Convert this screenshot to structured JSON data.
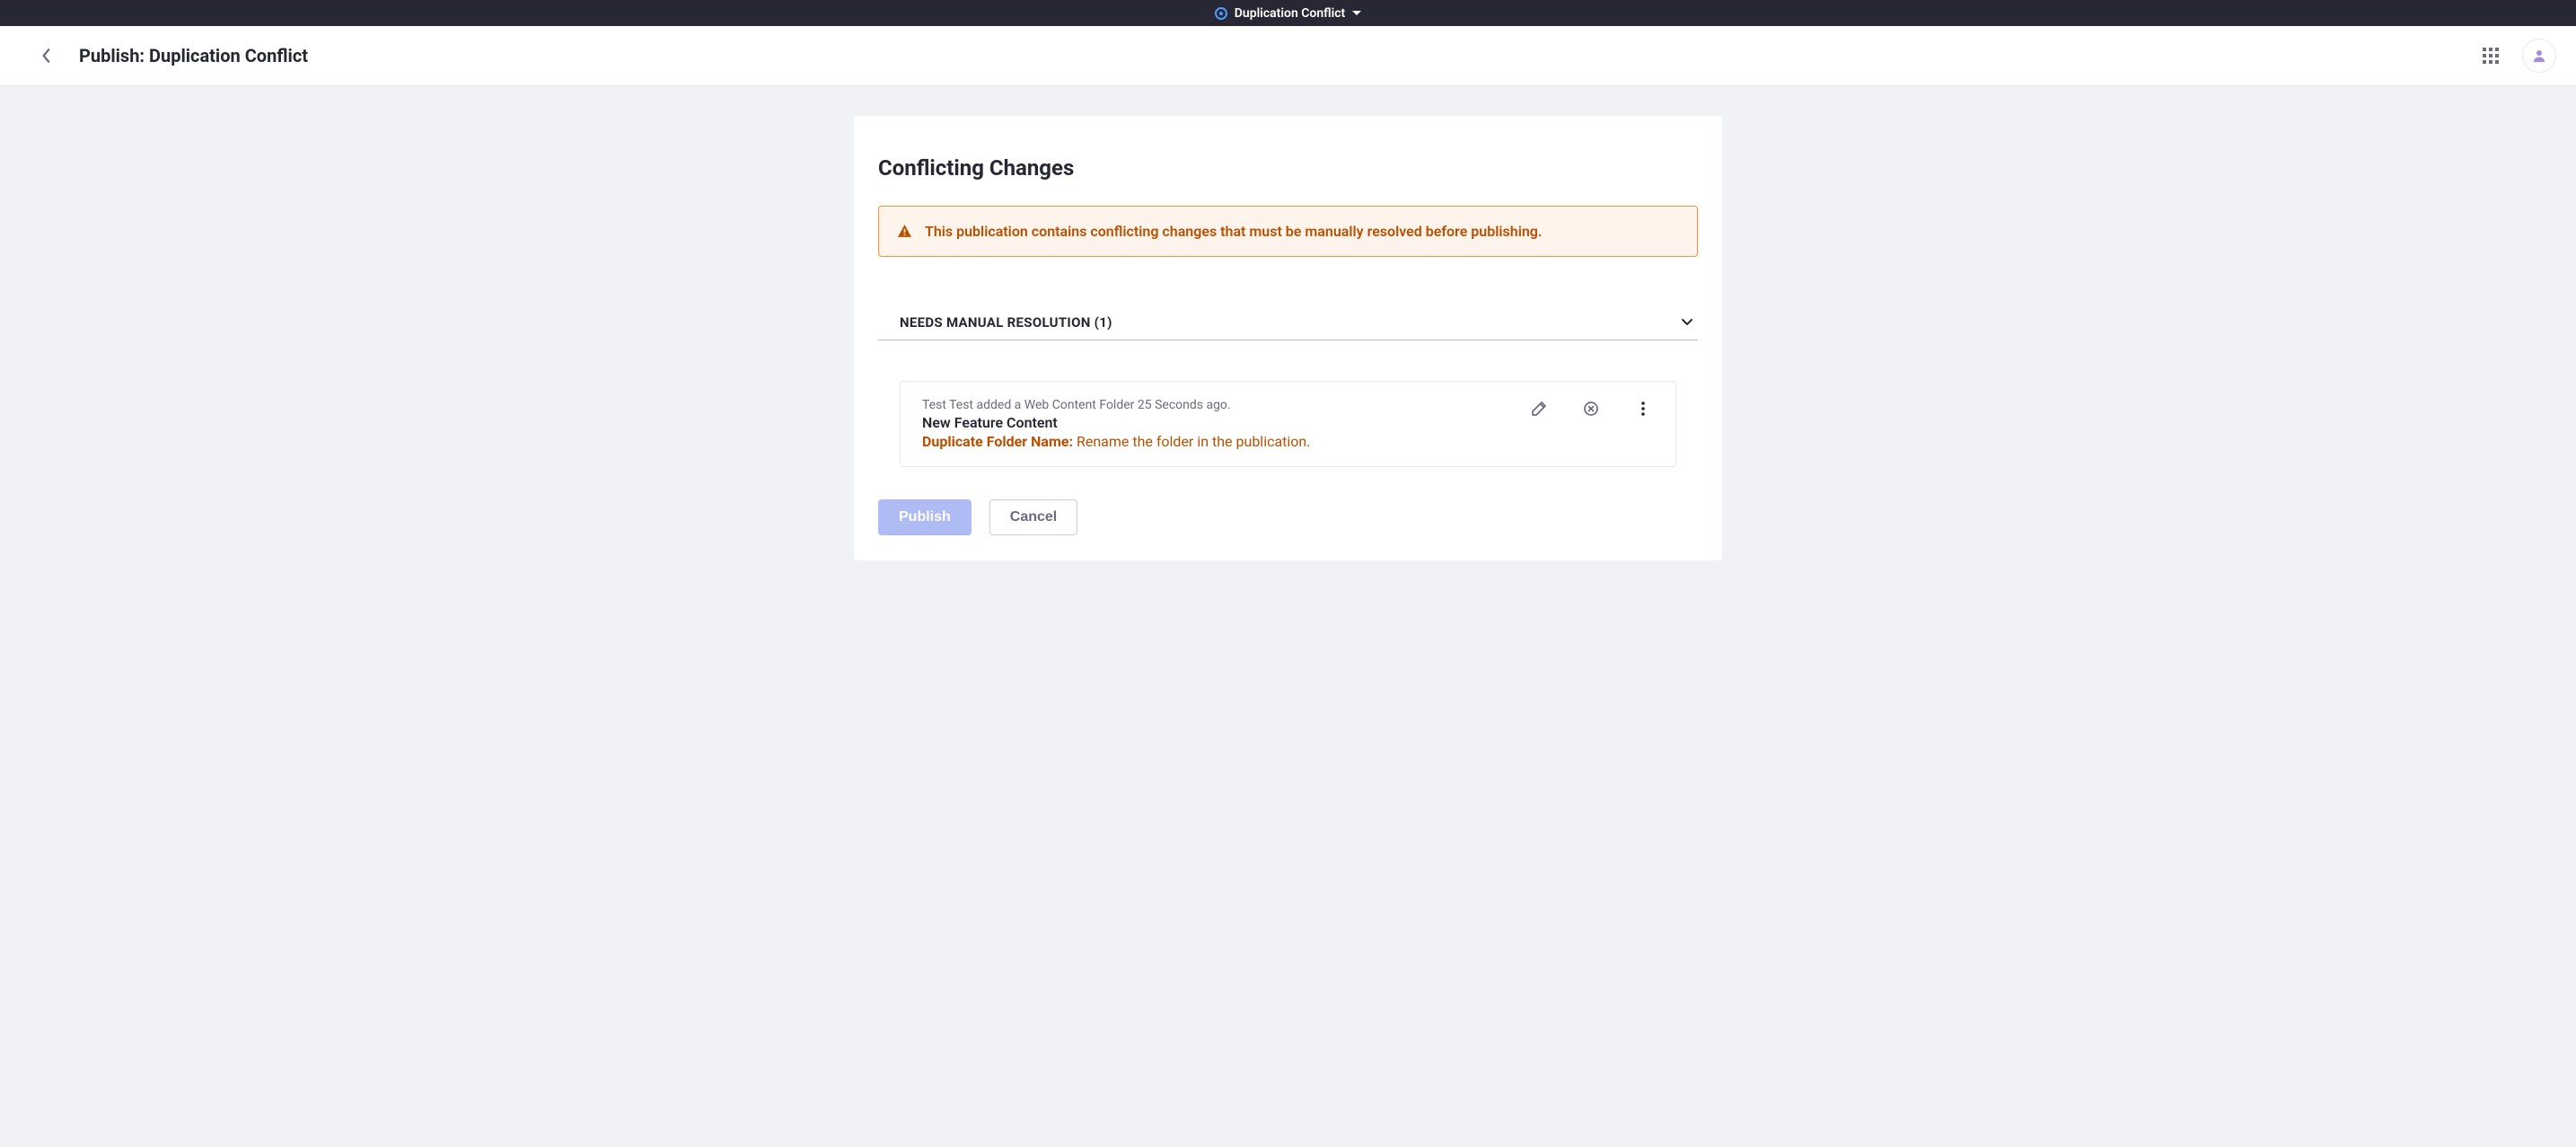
{
  "topbar": {
    "title": "Duplication Conflict"
  },
  "header": {
    "title": "Publish: Duplication Conflict"
  },
  "card": {
    "title": "Conflicting Changes"
  },
  "alert": {
    "message": "This publication contains conflicting changes that must be manually resolved before publishing."
  },
  "section": {
    "title": "NEEDS MANUAL RESOLUTION (1)"
  },
  "conflict": {
    "meta": "Test Test added a Web Content Folder 25 Seconds ago.",
    "title": "New Feature Content",
    "warning_label": "Duplicate Folder Name: ",
    "warning_text": "Rename the folder in the publication."
  },
  "buttons": {
    "publish": "Publish",
    "cancel": "Cancel"
  },
  "colors": {
    "warning": "#b95000",
    "warning_bg": "#fff4ec",
    "warning_border": "#ff8f39",
    "accent": "#8f7ddf"
  }
}
